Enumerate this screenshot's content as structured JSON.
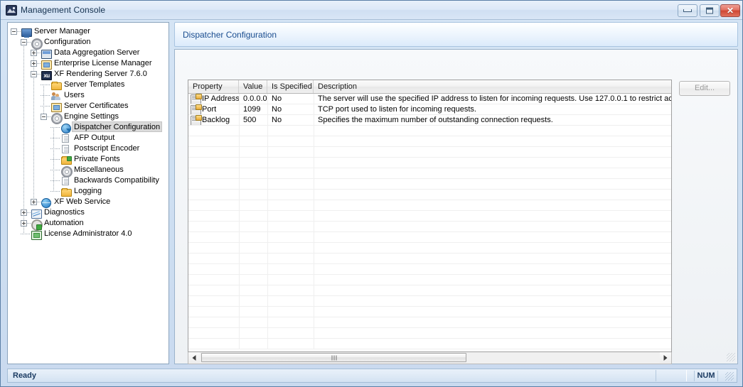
{
  "window": {
    "title": "Management Console",
    "icon": "app-icon",
    "controls": {
      "minimize": "minimize-button",
      "maximize": "maximize-button",
      "close_glyph": "✕"
    }
  },
  "tree": {
    "nodes": [
      {
        "label": "Server Manager",
        "depth": 0,
        "icon": "monitor-icon",
        "expander": "minus",
        "selected": false
      },
      {
        "label": "Configuration",
        "depth": 1,
        "icon": "gear-icon",
        "expander": "minus",
        "selected": false
      },
      {
        "label": "Data Aggregation Server",
        "depth": 2,
        "icon": "server-icon",
        "expander": "plus",
        "selected": false
      },
      {
        "label": "Enterprise License Manager",
        "depth": 2,
        "icon": "license-icon",
        "expander": "plus",
        "selected": false
      },
      {
        "label": "XF Rendering Server 7.6.0",
        "depth": 2,
        "icon": "xu-icon",
        "expander": "minus",
        "selected": false
      },
      {
        "label": "Server Templates",
        "depth": 3,
        "icon": "folder-icon",
        "expander": "none",
        "selected": false
      },
      {
        "label": "Users",
        "depth": 3,
        "icon": "users-icon",
        "expander": "none",
        "selected": false
      },
      {
        "label": "Server Certificates",
        "depth": 3,
        "icon": "certificate-icon",
        "expander": "none",
        "selected": false
      },
      {
        "label": "Engine Settings",
        "depth": 3,
        "icon": "gear-icon",
        "expander": "minus",
        "selected": false
      },
      {
        "label": "Dispatcher Configuration",
        "depth": 4,
        "icon": "dispatcher-icon",
        "expander": "none",
        "selected": true
      },
      {
        "label": "AFP Output",
        "depth": 4,
        "icon": "document-icon",
        "expander": "none",
        "selected": false
      },
      {
        "label": "Postscript Encoder",
        "depth": 4,
        "icon": "document-icon",
        "expander": "none",
        "selected": false
      },
      {
        "label": "Private Fonts",
        "depth": 4,
        "icon": "folder-green-icon",
        "expander": "none",
        "selected": false
      },
      {
        "label": "Miscellaneous",
        "depth": 4,
        "icon": "gear-icon",
        "expander": "none",
        "selected": false
      },
      {
        "label": "Backwards Compatibility",
        "depth": 4,
        "icon": "document-icon",
        "expander": "none",
        "selected": false
      },
      {
        "label": "Logging",
        "depth": 4,
        "icon": "folder-icon",
        "expander": "none",
        "selected": false
      },
      {
        "label": "XF Web Service",
        "depth": 2,
        "icon": "globe-icon",
        "expander": "plus",
        "selected": false
      },
      {
        "label": "Diagnostics",
        "depth": 1,
        "icon": "diagnostics-icon",
        "expander": "plus",
        "selected": false
      },
      {
        "label": "Automation",
        "depth": 1,
        "icon": "automation-icon",
        "expander": "plus",
        "selected": false
      },
      {
        "label": "License Administrator 4.0",
        "depth": 1,
        "icon": "license-admin-icon",
        "expander": "none",
        "selected": false
      }
    ]
  },
  "header": {
    "title": "Dispatcher Configuration"
  },
  "toolbar": {
    "edit_label": "Edit..."
  },
  "grid": {
    "columns": [
      {
        "label": "Property"
      },
      {
        "label": "Value"
      },
      {
        "label": "Is Specified"
      },
      {
        "label": "Description"
      }
    ],
    "rows": [
      {
        "property": "IP Address",
        "value": "0.0.0.0",
        "is_specified": "No",
        "description": "The server will use the specified IP address to listen for incoming requests. Use 127.0.0.1 to restrict access or"
      },
      {
        "property": "Port",
        "value": "1099",
        "is_specified": "No",
        "description": "TCP port used to listen for incoming requests."
      },
      {
        "property": "Backlog",
        "value": "500",
        "is_specified": "No",
        "description": "Specifies the maximum number of outstanding connection requests."
      }
    ]
  },
  "scrollbar": {
    "left_arrow": "scroll-left-arrow",
    "right_arrow": "scroll-right-arrow",
    "thumb": "horizontal-scroll-thumb"
  },
  "statusbar": {
    "status": "Ready",
    "num_indicator": "NUM"
  }
}
